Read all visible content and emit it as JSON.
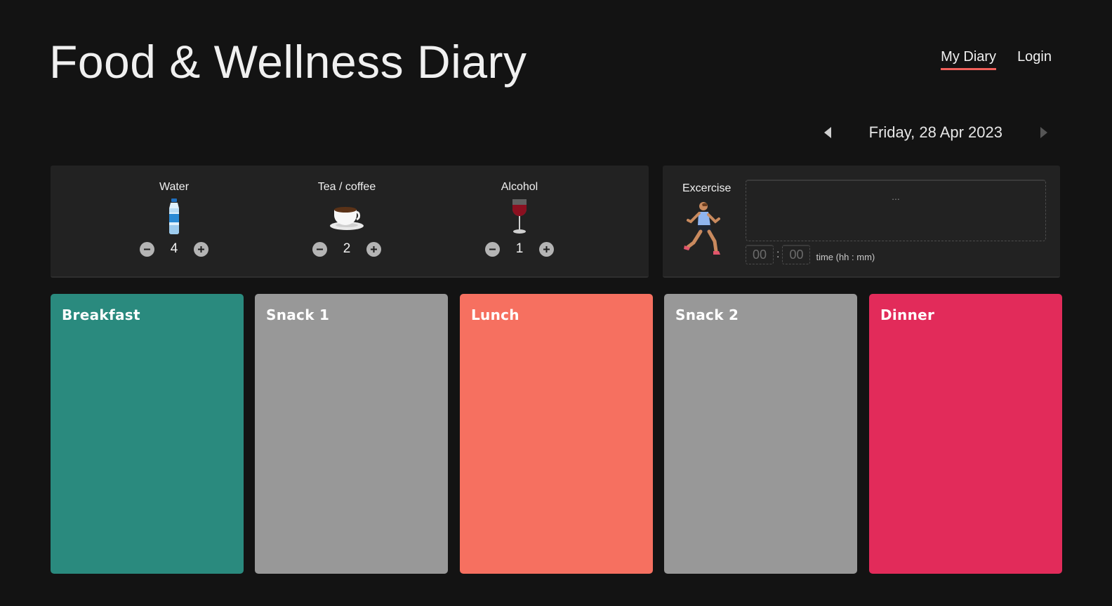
{
  "app": {
    "title": "Food & Wellness Diary"
  },
  "nav": {
    "items": [
      {
        "label": "My Diary",
        "active": true
      },
      {
        "label": "Login",
        "active": false
      }
    ]
  },
  "date": {
    "label": "Friday, 28 Apr 2023"
  },
  "drinks": [
    {
      "label": "Water",
      "icon": "water-bottle-icon",
      "count": "4"
    },
    {
      "label": "Tea / coffee",
      "icon": "coffee-cup-icon",
      "count": "2"
    },
    {
      "label": "Alcohol",
      "icon": "wine-glass-icon",
      "count": "1"
    }
  ],
  "exercise": {
    "label": "Excercise",
    "icon": "runner-icon",
    "notes_placeholder": "...",
    "hours_placeholder": "00",
    "minutes_placeholder": "00",
    "separator": ":",
    "time_hint": "time (hh : mm)"
  },
  "meals": [
    {
      "label": "Breakfast",
      "color": "#2a8a7e"
    },
    {
      "label": "Snack 1",
      "color": "#989898"
    },
    {
      "label": "Lunch",
      "color": "#f67060"
    },
    {
      "label": "Snack 2",
      "color": "#989898"
    },
    {
      "label": "Dinner",
      "color": "#e22b5a"
    }
  ],
  "theme": {
    "background": "#131313",
    "panel": "#222222",
    "accent": "#f0605a"
  }
}
